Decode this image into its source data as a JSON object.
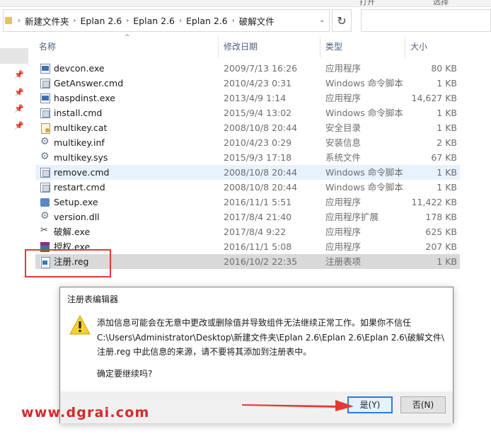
{
  "ribbon": {
    "fragments": [
      "打开",
      "选择"
    ]
  },
  "address": {
    "crumbs": [
      "新建文件夹",
      "Eplan 2.6",
      "Eplan 2.6",
      "Eplan 2.6",
      "破解文件"
    ]
  },
  "columns": {
    "name": "名称",
    "date": "修改日期",
    "type": "类型",
    "size": "大小"
  },
  "files": [
    {
      "name": "devcon.exe",
      "date": "2009/7/13 16:26",
      "type": "应用程序",
      "size": "80 KB",
      "icon": "exe"
    },
    {
      "name": "GetAnswer.cmd",
      "date": "2010/4/23 0:31",
      "type": "Windows 命令脚本",
      "size": "1 KB",
      "icon": "cmd"
    },
    {
      "name": "haspdinst.exe",
      "date": "2013/4/9 1:14",
      "type": "应用程序",
      "size": "14,627 KB",
      "icon": "exe"
    },
    {
      "name": "install.cmd",
      "date": "2015/9/4 13:02",
      "type": "Windows 命令脚本",
      "size": "1 KB",
      "icon": "cmd"
    },
    {
      "name": "multikey.cat",
      "date": "2008/10/8 20:44",
      "type": "安全目录",
      "size": "1 KB",
      "icon": "cert"
    },
    {
      "name": "multikey.inf",
      "date": "2010/4/23 0:29",
      "type": "安装信息",
      "size": "2 KB",
      "icon": "gear"
    },
    {
      "name": "multikey.sys",
      "date": "2015/9/3 17:18",
      "type": "系统文件",
      "size": "67 KB",
      "icon": "gear"
    },
    {
      "name": "remove.cmd",
      "date": "2008/10/8 20:44",
      "type": "Windows 命令脚本",
      "size": "1 KB",
      "icon": "cmd"
    },
    {
      "name": "restart.cmd",
      "date": "2008/10/8 20:44",
      "type": "Windows 命令脚本",
      "size": "1 KB",
      "icon": "cmd"
    },
    {
      "name": "Setup.exe",
      "date": "2016/11/1 5:51",
      "type": "应用程序",
      "size": "11,422 KB",
      "icon": "setup"
    },
    {
      "name": "version.dll",
      "date": "2017/8/4 21:40",
      "type": "应用程序扩展",
      "size": "178 KB",
      "icon": "gear"
    },
    {
      "name": "破解.exe",
      "date": "2017/8/4 9:22",
      "type": "应用程序",
      "size": "625 KB",
      "icon": "crack"
    },
    {
      "name": "授权.exe",
      "date": "2016/11/1 5:08",
      "type": "应用程序",
      "size": "207 KB",
      "icon": "rar"
    },
    {
      "name": "注册.reg",
      "date": "2016/10/2 22:35",
      "type": "注册表项",
      "size": "1 KB",
      "icon": "reg"
    }
  ],
  "dialog": {
    "title": "注册表编辑器",
    "message_lines": [
      "添加信息可能会在无意中更改或删除值并导致组件无法继续正常工作。如果你不信任",
      "C:\\Users\\Administrator\\Desktop\\新建文件夹\\Eplan 2.6\\Eplan 2.6\\Eplan 2.6\\破解文件\\",
      "注册.reg 中此信息的来源，请不要将其添加到注册表中。"
    ],
    "question": "确定要继续吗?",
    "yes_label": "是(Y)",
    "no_label": "否(N)"
  },
  "watermark": "www.dgrai.com",
  "colors": {
    "accent": "#2d7bd6",
    "highlight": "#e53935",
    "watermark": "#d62828"
  }
}
